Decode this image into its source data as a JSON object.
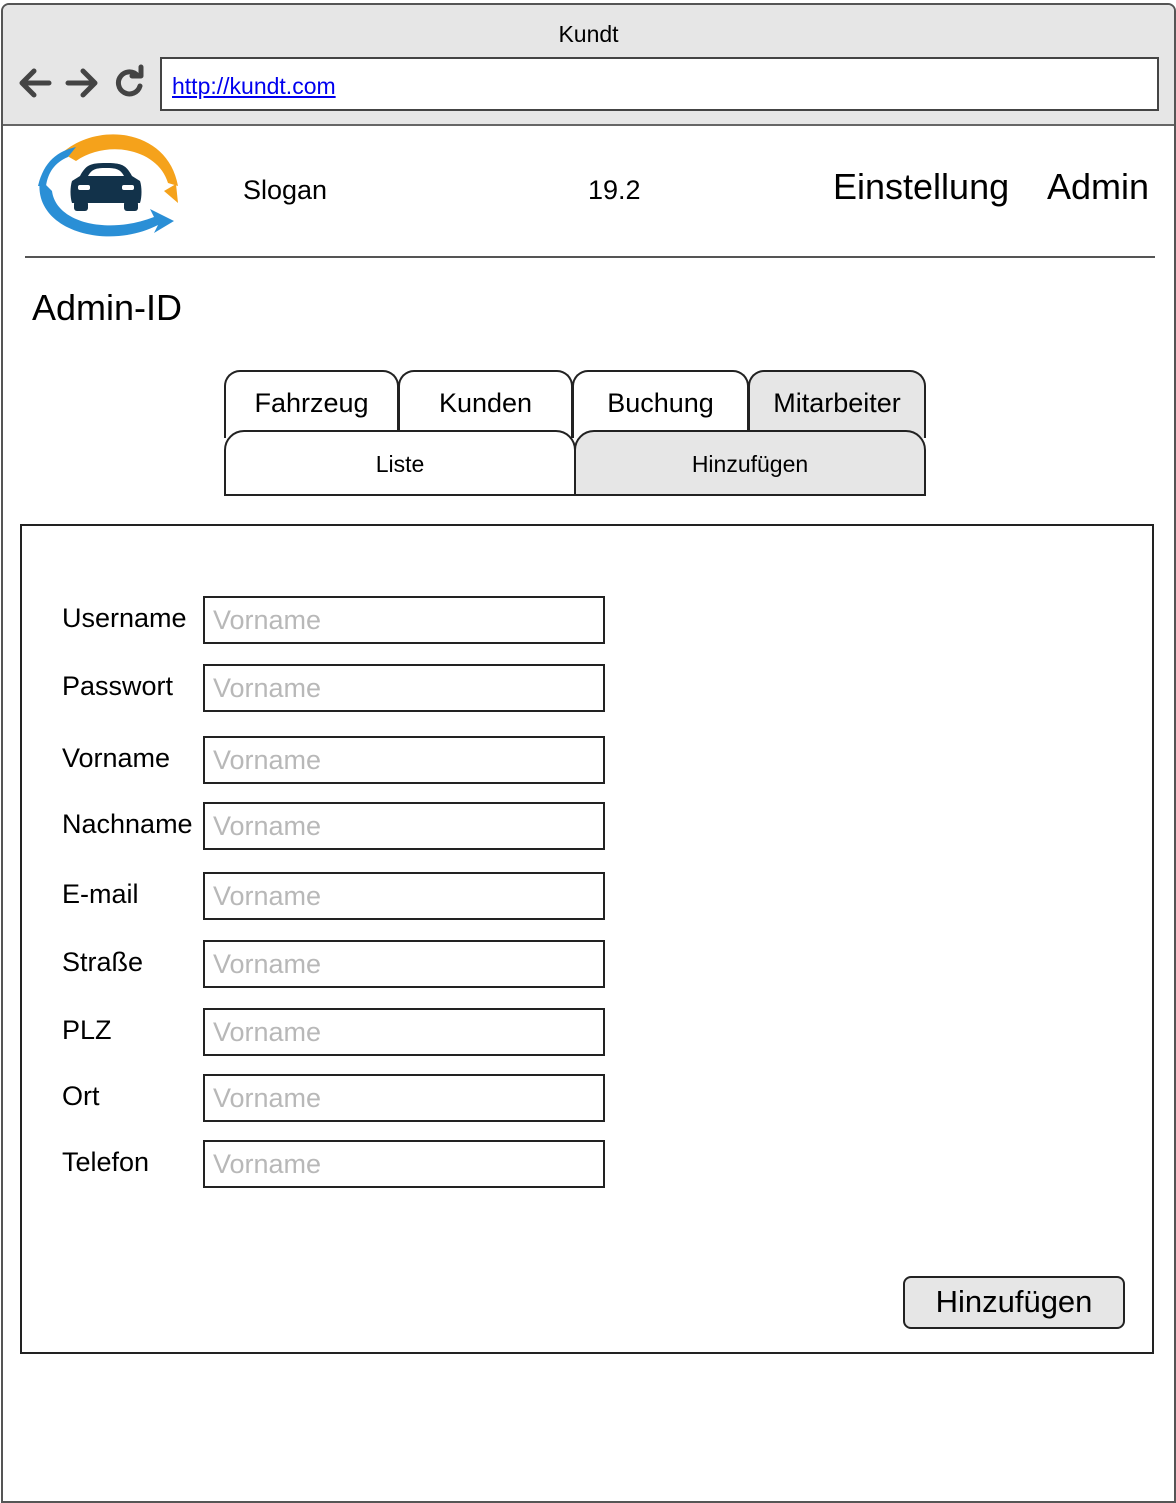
{
  "browser": {
    "window_title": "Kundt",
    "url": "http://kundt.com",
    "nav_icons": [
      "arrow-left-icon",
      "arrow-right-icon",
      "refresh-icon"
    ]
  },
  "header": {
    "logo_icon": "car-logo-icon",
    "slogan": "Slogan",
    "version": "19.2",
    "settings_link": "Einstellung",
    "admin_link": "Admin"
  },
  "page": {
    "title": "Admin-ID"
  },
  "tabs": [
    {
      "label": "Fahrzeug",
      "active": false
    },
    {
      "label": "Kunden",
      "active": false
    },
    {
      "label": "Buchung",
      "active": false
    },
    {
      "label": "Mitarbeiter",
      "active": true
    }
  ],
  "subtabs": [
    {
      "label": "Liste",
      "active": false
    },
    {
      "label": "Hinzufügen",
      "active": true
    }
  ],
  "form": {
    "fields": [
      {
        "label": "Username",
        "value": "",
        "placeholder": "Vorname"
      },
      {
        "label": "Passwort",
        "value": "",
        "placeholder": "Vorname"
      },
      {
        "label": "Vorname",
        "value": "",
        "placeholder": "Vorname"
      },
      {
        "label": "Nachname",
        "value": "",
        "placeholder": "Vorname"
      },
      {
        "label": "E-mail",
        "value": "",
        "placeholder": "Vorname"
      },
      {
        "label": "Straße",
        "value": "",
        "placeholder": "Vorname"
      },
      {
        "label": "PLZ",
        "value": "",
        "placeholder": "Vorname"
      },
      {
        "label": "Ort",
        "value": "",
        "placeholder": "Vorname"
      },
      {
        "label": "Telefon",
        "value": "",
        "placeholder": "Vorname"
      }
    ],
    "submit_label": "Hinzufügen"
  },
  "colors": {
    "chrome_bg": "#e6e6e6",
    "active_tab_bg": "#e6e6e6",
    "link": "#0000ee",
    "placeholder": "#b8b8b8",
    "logo_orange": "#f5a21b",
    "logo_blue": "#2a8fd6",
    "logo_car": "#12324a"
  }
}
